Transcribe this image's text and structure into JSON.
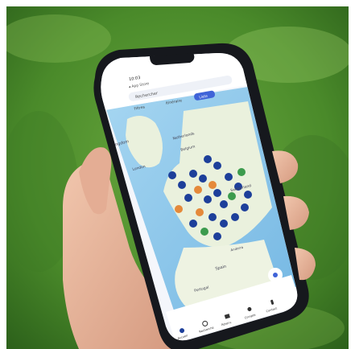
{
  "photo": {
    "description_free": true,
    "colors": {
      "grass_dark": "#2f6b1f",
      "grass_mid": "#4f8f2c",
      "grass_light": "#8cc05a",
      "skin": "#e9b9a0",
      "skin_shadow": "#c98f78",
      "phone_body": "#16181d",
      "screen_bg": "#f4f6fb",
      "sea": "#8ec9ec",
      "land": "#eaf1dd",
      "marker_blue": "#1d3f9a",
      "marker_orange": "#e5893a",
      "marker_green": "#3c9b4d",
      "accent": "#3f63d8"
    }
  },
  "phone_ui": {
    "status_time": "10:03",
    "back_label": "◂ App Store",
    "search_placeholder": "Rechercher",
    "chips": [
      "Filtres",
      "Itinéraire",
      "Liste"
    ],
    "map_labels": {
      "kingdom": "Kingdom",
      "london": "London",
      "netherlands": "Netherlands",
      "belgium": "Belgium",
      "switzerland": "Switzerland",
      "spain": "Spain",
      "portugal": "Portugal",
      "andorra": "Andorra"
    },
    "tab_bar": [
      {
        "label": "Accueil",
        "icon": "home-icon"
      },
      {
        "label": "Recherche",
        "icon": "search-icon"
      },
      {
        "label": "Réserv.",
        "icon": "calendar-icon"
      },
      {
        "label": "Compte",
        "icon": "user-icon"
      },
      {
        "label": "Contact",
        "icon": "phone-icon"
      }
    ]
  }
}
